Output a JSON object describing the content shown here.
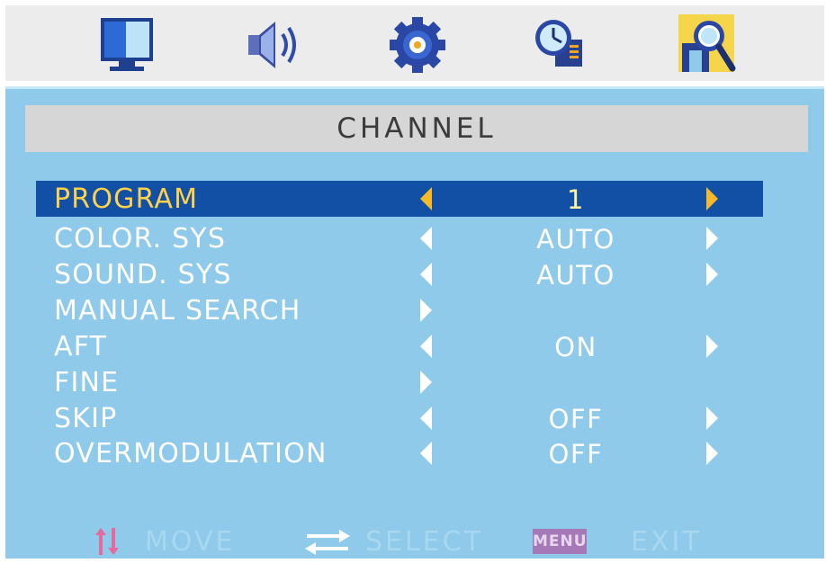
{
  "top_tabs": [
    {
      "icon": "picture-icon",
      "active": false
    },
    {
      "icon": "sound-icon",
      "active": false
    },
    {
      "icon": "setup-gear-icon",
      "active": false
    },
    {
      "icon": "time-clock-icon",
      "active": false
    },
    {
      "icon": "channel-search-icon",
      "active": true
    }
  ],
  "menu": {
    "title": "CHANNEL",
    "items": [
      {
        "label": "PROGRAM",
        "value": "1",
        "has_left_arrow": true,
        "has_right_arrow": true,
        "selected": true
      },
      {
        "label": "COLOR. SYS",
        "value": "AUTO",
        "has_left_arrow": true,
        "has_right_arrow": true,
        "selected": false
      },
      {
        "label": "SOUND. SYS",
        "value": "AUTO",
        "has_left_arrow": true,
        "has_right_arrow": true,
        "selected": false
      },
      {
        "label": "MANUAL SEARCH",
        "value": "",
        "has_left_arrow": false,
        "has_right_arrow": true,
        "selected": false
      },
      {
        "label": "AFT",
        "value": "ON",
        "has_left_arrow": true,
        "has_right_arrow": true,
        "selected": false
      },
      {
        "label": "FINE",
        "value": "",
        "has_left_arrow": false,
        "has_right_arrow": true,
        "selected": false
      },
      {
        "label": "SKIP",
        "value": "OFF",
        "has_left_arrow": true,
        "has_right_arrow": true,
        "selected": false
      },
      {
        "label": "OVERMODULATION",
        "value": "OFF",
        "has_left_arrow": true,
        "has_right_arrow": true,
        "selected": false
      }
    ]
  },
  "footer": {
    "move_label": "MOVE",
    "select_label": "SELECT",
    "menu_key_label": "MENU",
    "exit_label": "EXIT"
  },
  "colors": {
    "panel_background": "#8fcaea",
    "title_bar": "#d6d6d6",
    "selected_row": "#1250a5",
    "selected_text": "#ffd24a",
    "arrow_active": "#f7b928",
    "text": "#ffffff",
    "footer_hint": "#a7d8f0",
    "menu_key": "#a578b8"
  }
}
